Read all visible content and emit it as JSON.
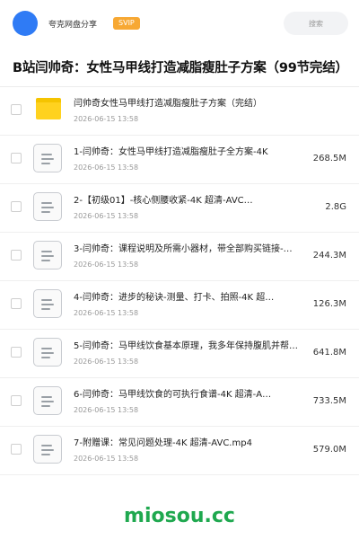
{
  "header": {
    "app_name": "夸克网盘分享",
    "badge": "SVIP",
    "search_placeholder": "搜索",
    "accent_color": "#2f7bf5",
    "badge_color": "#f7a833"
  },
  "share": {
    "title": "B站闫帅奇：女性马甲线打造减脂瘦肚子方案（99节完结）"
  },
  "files": [
    {
      "icon": "folder-icon",
      "name": "闫帅奇女性马甲线打造减脂瘦肚子方案（完结）",
      "date": "2026-06-15 13:58",
      "size": ""
    },
    {
      "icon": "file-icon",
      "name": "1-闫帅奇：女性马甲线打造减脂瘦肚子全方案-4K",
      "date": "2026-06-15 13:58",
      "size": "268.5M"
    },
    {
      "icon": "file-icon",
      "name": "2-【初级01】-核心侧腰收紧-4K 超清-AVC…",
      "date": "2026-06-15 13:58",
      "size": "2.8G"
    },
    {
      "icon": "file-icon",
      "name": "3-闫帅奇：课程说明及所需小器材，带全部购买链接-…",
      "date": "2026-06-15 13:58",
      "size": "244.3M"
    },
    {
      "icon": "file-icon",
      "name": "4-闫帅奇：进步的秘诀-测量、打卡、拍照-4K 超…",
      "date": "2026-06-15 13:58",
      "size": "126.3M"
    },
    {
      "icon": "file-icon",
      "name": "5-闫帅奇：马甲线饮食基本原理，我多年保持腹肌并帮…",
      "date": "2026-06-15 13:58",
      "size": "641.8M"
    },
    {
      "icon": "file-icon",
      "name": "6-闫帅奇：马甲线饮食的可执行食谱-4K 超清-A…",
      "date": "2026-06-15 13:58",
      "size": "733.5M"
    },
    {
      "icon": "file-icon",
      "name": "7-附赠课：常见问题处理-4K 超清-AVC.mp4",
      "date": "2026-06-15 13:58",
      "size": "579.0M"
    }
  ],
  "footer": {
    "brand": "miosou.cc",
    "brand_color": "#1fa84f"
  }
}
